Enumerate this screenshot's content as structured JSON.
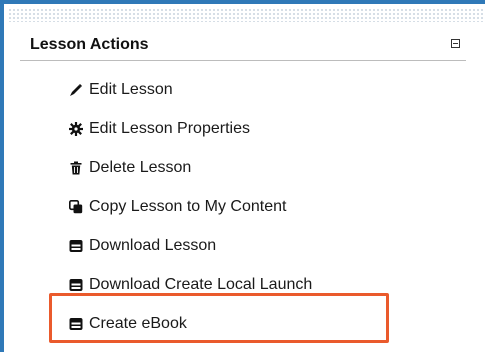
{
  "panel": {
    "title": "Lesson Actions"
  },
  "menu": {
    "items": [
      {
        "label": "Edit Lesson",
        "icon": "pencil-icon"
      },
      {
        "label": "Edit Lesson Properties",
        "icon": "gear-icon"
      },
      {
        "label": "Delete Lesson",
        "icon": "trash-icon"
      },
      {
        "label": "Copy Lesson to My Content",
        "icon": "copy-icon"
      },
      {
        "label": "Download Lesson",
        "icon": "download-icon"
      },
      {
        "label": "Download Create Local Launch",
        "icon": "download-icon"
      },
      {
        "label": "Create eBook",
        "icon": "ebook-icon"
      }
    ]
  },
  "colors": {
    "frame_border": "#2f79b8",
    "highlight": "#ea5a2c",
    "text": "#1a1a1a"
  }
}
